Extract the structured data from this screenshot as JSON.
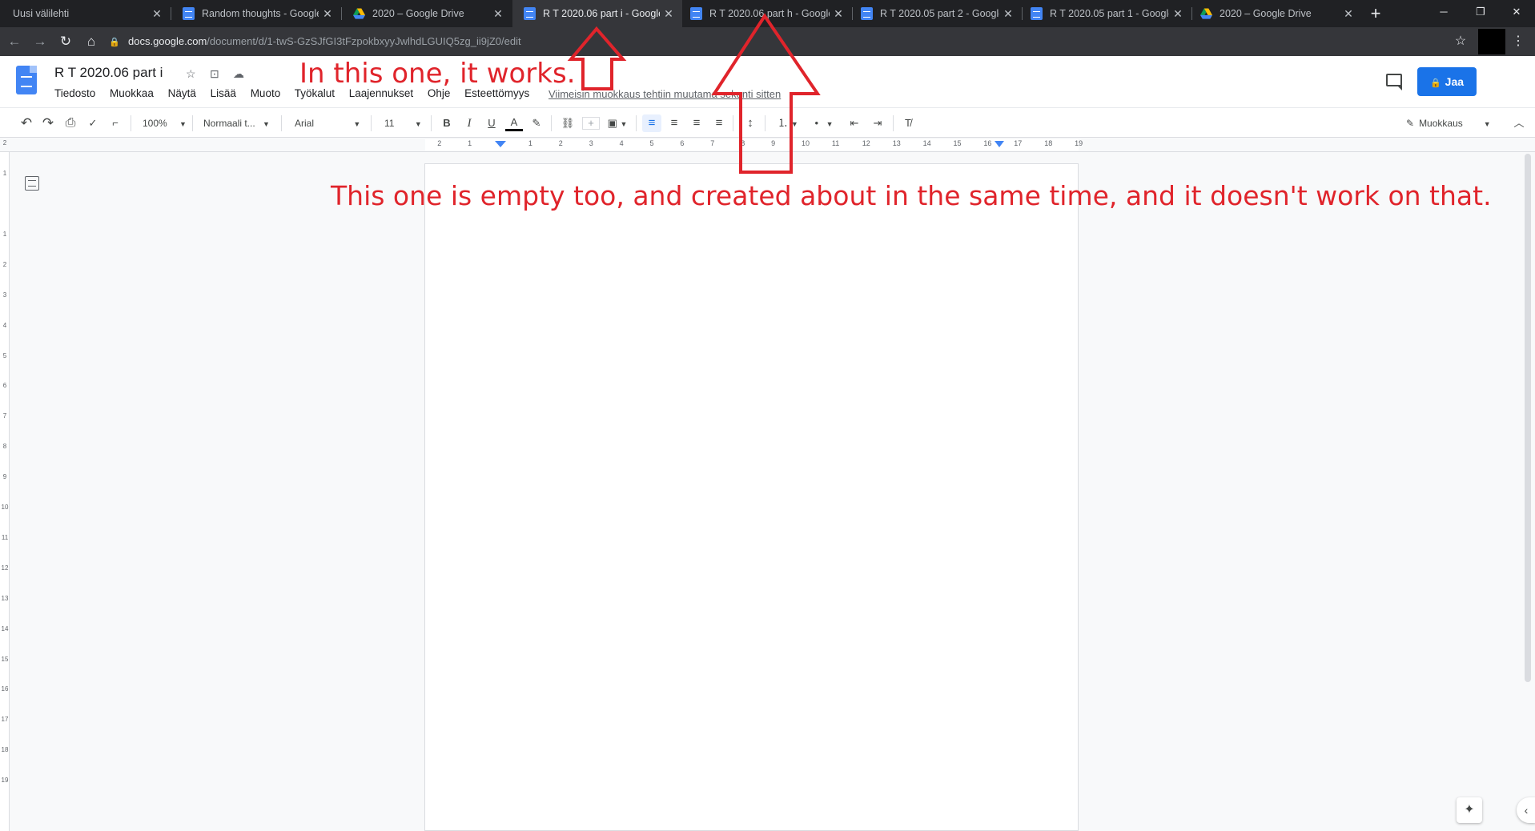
{
  "browser": {
    "tabs": [
      {
        "title": "Uusi välilehti",
        "icon": "none"
      },
      {
        "title": "Random thoughts - Google",
        "icon": "docs-icon"
      },
      {
        "title": "2020 – Google Drive",
        "icon": "drive-icon"
      },
      {
        "title": "R T 2020.06 part i - Google",
        "icon": "docs-icon"
      },
      {
        "title": "R T 2020.06 part h - Google",
        "icon": "docs-icon"
      },
      {
        "title": "R T 2020.05 part 2 - Google",
        "icon": "docs-icon"
      },
      {
        "title": "R T 2020.05 part 1 - Google",
        "icon": "docs-icon"
      },
      {
        "title": "2020 – Google Drive",
        "icon": "drive-icon"
      }
    ],
    "active_tab_index": 3,
    "close_glyph": "✕",
    "new_tab_glyph": "+",
    "window_controls": {
      "minimize": "─",
      "restore": "❐",
      "close": "✕"
    },
    "url_host": "docs.google.com",
    "url_path": "/document/d/1-twS-GzSJfGI3tFzpokbxyyJwlhdLGUIQ5zg_ii9jZ0/edit",
    "back_glyph": "←",
    "forward_glyph": "→",
    "reload_glyph": "↻",
    "home_glyph": "⌂",
    "star_glyph": "☆",
    "menu_glyph": "⋮"
  },
  "docs": {
    "title": "R T 2020.06 part i",
    "title_icons": {
      "star": "☆",
      "move": "⊡",
      "cloud": "☁"
    },
    "menu": [
      "Tiedosto",
      "Muokkaa",
      "Näytä",
      "Lisää",
      "Muoto",
      "Työkalut",
      "Laajennukset",
      "Ohje",
      "Esteettömyys"
    ],
    "last_edit": "Viimeisin muokkaus tehtiin muutama sekunti sitten",
    "share_label": "Jaa",
    "share_icon": "🔒",
    "toolbar": {
      "undo": "↶",
      "redo": "↷",
      "print": "⎙",
      "spellcheck": "✓",
      "paint_format": "⌐",
      "zoom": "100%",
      "style": "Normaali t...",
      "font": "Arial",
      "font_size": "11",
      "bold": "B",
      "italic": "I",
      "underline": "U",
      "text_color": "A",
      "highlight": "✎",
      "link": "⛓",
      "comment": "+",
      "image": "▣",
      "align_left": "≡",
      "align_center": "≡",
      "align_right": "≡",
      "justify": "≡",
      "line_spacing": "↕",
      "numbered_list": "⒈",
      "bulleted_list": "•",
      "decrease_indent": "⇤",
      "increase_indent": "⇥",
      "clear_formatting": "T̸",
      "mode": "Muokkaus",
      "collapse": "︿"
    },
    "ruler_labels": [
      "2",
      "1",
      "1",
      "2",
      "3",
      "4",
      "5",
      "6",
      "7",
      "8",
      "9",
      "10",
      "11",
      "12",
      "13",
      "14",
      "15",
      "16",
      "17",
      "18",
      "19"
    ],
    "vruler_labels": [
      "2",
      "1",
      "1",
      "2",
      "3",
      "4",
      "5",
      "6",
      "7",
      "8",
      "9",
      "10",
      "11",
      "12",
      "13",
      "14",
      "15",
      "16",
      "17",
      "18",
      "19"
    ],
    "explore_glyph": "✦",
    "side_toggle_glyph": "‹"
  },
  "annotations": {
    "works_text": "In this one, it works.",
    "not_work_text": "This one is empty too, and created about in the same time, and it doesn't work on that.",
    "color": "#e0242b"
  },
  "colors": {
    "chrome_dark": "#202124",
    "chrome_active": "#35363a",
    "docs_blue": "#4285f4",
    "share_blue": "#1a73e8"
  }
}
